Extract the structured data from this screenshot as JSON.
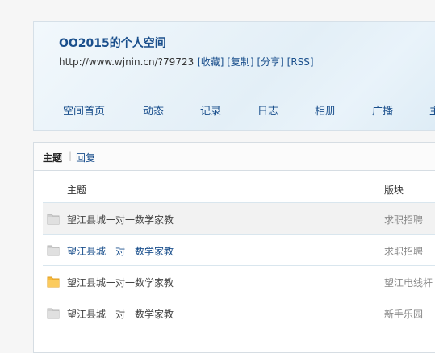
{
  "header": {
    "title": "OO2015的个人空间",
    "url": "http://www.wjnin.cn/?79723",
    "actions": [
      "[收藏]",
      "[复制]",
      "[分享]",
      "[RSS]"
    ]
  },
  "nav": {
    "items": [
      "空间首页",
      "动态",
      "记录",
      "日志",
      "相册",
      "广播",
      "主"
    ]
  },
  "tabs": {
    "active": "主题",
    "separator": "|",
    "other": "回复"
  },
  "table": {
    "columns": [
      "主题",
      "版块"
    ],
    "rows": [
      {
        "subject": "望江县城一对一数学家教",
        "forum": "求职招聘",
        "icon": "folder-gray-icon",
        "highlight": true
      },
      {
        "subject": "望江县城一对一数学家教",
        "forum": "求职招聘",
        "icon": "folder-gray-icon",
        "highlight": false
      },
      {
        "subject": "望江县城一对一数学家教",
        "forum": "望江电线杆",
        "icon": "folder-yellow-icon",
        "highlight": false
      },
      {
        "subject": "望江县城一对一数学家教",
        "forum": "新手乐园",
        "icon": "folder-gray-icon",
        "highlight": false
      }
    ]
  },
  "colors": {
    "link": "#1a4f8c",
    "folder_gray": "#cfcfcf",
    "folder_yellow": "#f6b93b"
  }
}
